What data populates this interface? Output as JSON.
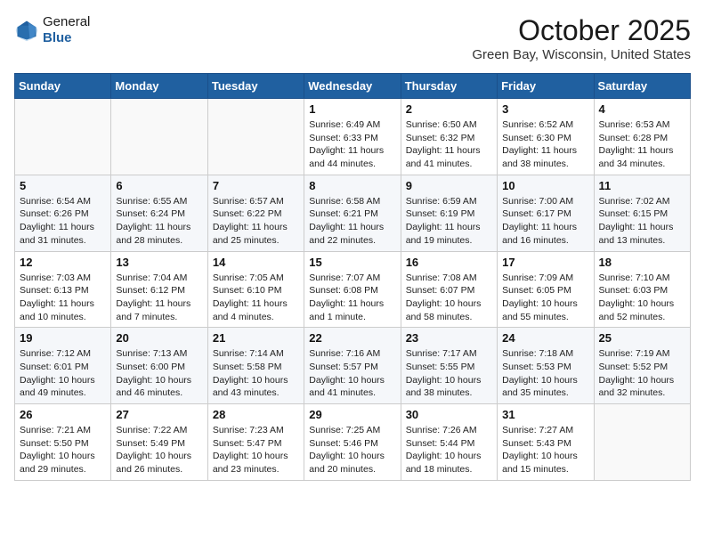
{
  "header": {
    "logo_line1": "General",
    "logo_line2": "Blue",
    "month_title": "October 2025",
    "location": "Green Bay, Wisconsin, United States"
  },
  "weekdays": [
    "Sunday",
    "Monday",
    "Tuesday",
    "Wednesday",
    "Thursday",
    "Friday",
    "Saturday"
  ],
  "weeks": [
    [
      {
        "day": "",
        "info": ""
      },
      {
        "day": "",
        "info": ""
      },
      {
        "day": "",
        "info": ""
      },
      {
        "day": "1",
        "info": "Sunrise: 6:49 AM\nSunset: 6:33 PM\nDaylight: 11 hours\nand 44 minutes."
      },
      {
        "day": "2",
        "info": "Sunrise: 6:50 AM\nSunset: 6:32 PM\nDaylight: 11 hours\nand 41 minutes."
      },
      {
        "day": "3",
        "info": "Sunrise: 6:52 AM\nSunset: 6:30 PM\nDaylight: 11 hours\nand 38 minutes."
      },
      {
        "day": "4",
        "info": "Sunrise: 6:53 AM\nSunset: 6:28 PM\nDaylight: 11 hours\nand 34 minutes."
      }
    ],
    [
      {
        "day": "5",
        "info": "Sunrise: 6:54 AM\nSunset: 6:26 PM\nDaylight: 11 hours\nand 31 minutes."
      },
      {
        "day": "6",
        "info": "Sunrise: 6:55 AM\nSunset: 6:24 PM\nDaylight: 11 hours\nand 28 minutes."
      },
      {
        "day": "7",
        "info": "Sunrise: 6:57 AM\nSunset: 6:22 PM\nDaylight: 11 hours\nand 25 minutes."
      },
      {
        "day": "8",
        "info": "Sunrise: 6:58 AM\nSunset: 6:21 PM\nDaylight: 11 hours\nand 22 minutes."
      },
      {
        "day": "9",
        "info": "Sunrise: 6:59 AM\nSunset: 6:19 PM\nDaylight: 11 hours\nand 19 minutes."
      },
      {
        "day": "10",
        "info": "Sunrise: 7:00 AM\nSunset: 6:17 PM\nDaylight: 11 hours\nand 16 minutes."
      },
      {
        "day": "11",
        "info": "Sunrise: 7:02 AM\nSunset: 6:15 PM\nDaylight: 11 hours\nand 13 minutes."
      }
    ],
    [
      {
        "day": "12",
        "info": "Sunrise: 7:03 AM\nSunset: 6:13 PM\nDaylight: 11 hours\nand 10 minutes."
      },
      {
        "day": "13",
        "info": "Sunrise: 7:04 AM\nSunset: 6:12 PM\nDaylight: 11 hours\nand 7 minutes."
      },
      {
        "day": "14",
        "info": "Sunrise: 7:05 AM\nSunset: 6:10 PM\nDaylight: 11 hours\nand 4 minutes."
      },
      {
        "day": "15",
        "info": "Sunrise: 7:07 AM\nSunset: 6:08 PM\nDaylight: 11 hours\nand 1 minute."
      },
      {
        "day": "16",
        "info": "Sunrise: 7:08 AM\nSunset: 6:07 PM\nDaylight: 10 hours\nand 58 minutes."
      },
      {
        "day": "17",
        "info": "Sunrise: 7:09 AM\nSunset: 6:05 PM\nDaylight: 10 hours\nand 55 minutes."
      },
      {
        "day": "18",
        "info": "Sunrise: 7:10 AM\nSunset: 6:03 PM\nDaylight: 10 hours\nand 52 minutes."
      }
    ],
    [
      {
        "day": "19",
        "info": "Sunrise: 7:12 AM\nSunset: 6:01 PM\nDaylight: 10 hours\nand 49 minutes."
      },
      {
        "day": "20",
        "info": "Sunrise: 7:13 AM\nSunset: 6:00 PM\nDaylight: 10 hours\nand 46 minutes."
      },
      {
        "day": "21",
        "info": "Sunrise: 7:14 AM\nSunset: 5:58 PM\nDaylight: 10 hours\nand 43 minutes."
      },
      {
        "day": "22",
        "info": "Sunrise: 7:16 AM\nSunset: 5:57 PM\nDaylight: 10 hours\nand 41 minutes."
      },
      {
        "day": "23",
        "info": "Sunrise: 7:17 AM\nSunset: 5:55 PM\nDaylight: 10 hours\nand 38 minutes."
      },
      {
        "day": "24",
        "info": "Sunrise: 7:18 AM\nSunset: 5:53 PM\nDaylight: 10 hours\nand 35 minutes."
      },
      {
        "day": "25",
        "info": "Sunrise: 7:19 AM\nSunset: 5:52 PM\nDaylight: 10 hours\nand 32 minutes."
      }
    ],
    [
      {
        "day": "26",
        "info": "Sunrise: 7:21 AM\nSunset: 5:50 PM\nDaylight: 10 hours\nand 29 minutes."
      },
      {
        "day": "27",
        "info": "Sunrise: 7:22 AM\nSunset: 5:49 PM\nDaylight: 10 hours\nand 26 minutes."
      },
      {
        "day": "28",
        "info": "Sunrise: 7:23 AM\nSunset: 5:47 PM\nDaylight: 10 hours\nand 23 minutes."
      },
      {
        "day": "29",
        "info": "Sunrise: 7:25 AM\nSunset: 5:46 PM\nDaylight: 10 hours\nand 20 minutes."
      },
      {
        "day": "30",
        "info": "Sunrise: 7:26 AM\nSunset: 5:44 PM\nDaylight: 10 hours\nand 18 minutes."
      },
      {
        "day": "31",
        "info": "Sunrise: 7:27 AM\nSunset: 5:43 PM\nDaylight: 10 hours\nand 15 minutes."
      },
      {
        "day": "",
        "info": ""
      }
    ]
  ]
}
